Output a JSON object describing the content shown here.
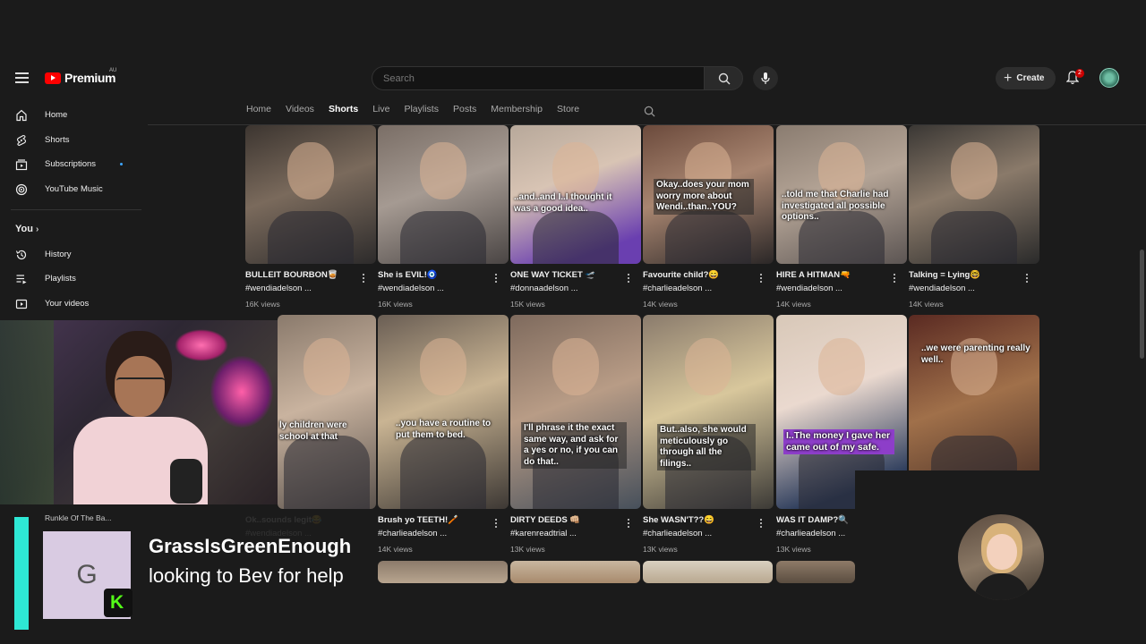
{
  "header": {
    "logo_text": "Premium",
    "region": "AU",
    "search_placeholder": "Search",
    "create_label": "Create",
    "notifications_count": "2"
  },
  "sidebar": {
    "items": [
      {
        "label": "Home",
        "icon": "home-icon"
      },
      {
        "label": "Shorts",
        "icon": "shorts-icon"
      },
      {
        "label": "Subscriptions",
        "icon": "subscriptions-icon"
      },
      {
        "label": "YouTube Music",
        "icon": "music-icon"
      }
    ],
    "you_label": "You",
    "you_items": [
      {
        "label": "History",
        "icon": "history-icon"
      },
      {
        "label": "Playlists",
        "icon": "playlists-icon"
      },
      {
        "label": "Your videos",
        "icon": "your-videos-icon"
      }
    ]
  },
  "tabs": [
    "Home",
    "Videos",
    "Shorts",
    "Live",
    "Playlists",
    "Posts",
    "Membership",
    "Store"
  ],
  "active_tab": "Shorts",
  "shorts_row1": [
    {
      "title": "BULLEIT BOURBON🥃",
      "tag": "#wendiadelson ...",
      "views": "16K views",
      "caption": ""
    },
    {
      "title": "She is EVIL!🧿",
      "tag": "#wendiadelson ...",
      "views": "16K views",
      "caption": ""
    },
    {
      "title": "ONE WAY TICKET 🛫",
      "tag": "#donnaadelson ...",
      "views": "15K views",
      "caption": "..and..and I..I thought it was a good idea.."
    },
    {
      "title": "Favourite child?😄",
      "tag": "#charlieadelson ...",
      "views": "14K views",
      "caption": "Okay..does your mom worry more about Wendi..than..YOU?"
    },
    {
      "title": "HIRE A HITMAN🔫",
      "tag": "#wendiadelson ...",
      "views": "14K views",
      "caption": "..told me that Charlie had investigated all possible options.."
    },
    {
      "title": "Talking = Lying🤓",
      "tag": "#wendiadelson ...",
      "views": "14K views",
      "caption": ""
    }
  ],
  "shorts_row2": [
    {
      "title": "Ok..sounds legit😂",
      "tag": "#wendiadelson ...",
      "views": "",
      "caption": "ly children were school at that"
    },
    {
      "title": "Brush yo TEETH!🪥",
      "tag": "#charlieadelson ...",
      "views": "14K views",
      "caption": "..you have a routine to put them to bed."
    },
    {
      "title": "DIRTY DEEDS 👊🏼",
      "tag": "#karenreadtrial ...",
      "views": "13K views",
      "caption": "I'll phrase it the exact same way, and ask for a yes or no, if you can do that.."
    },
    {
      "title": "She WASN'T??😄",
      "tag": "#charlieadelson ...",
      "views": "13K views",
      "caption": "But..also, she would meticulously go through all the filings.."
    },
    {
      "title": "WAS IT DAMP?🔍",
      "tag": "#charlieadelson ...",
      "views": "13K views",
      "caption": "I..The money I gave her came out of my safe."
    },
    {
      "title": "",
      "tag": "",
      "views": "",
      "caption": "..we were parenting really well.."
    }
  ],
  "stream": {
    "rumble_label": "Runkle Of The Ba...",
    "chat_initial": "G",
    "chat_user": "GrassIsGreenEnough",
    "chat_message": "looking to Bev for help",
    "kick_badge": "K"
  },
  "colors": {
    "accent_red": "#ff0000",
    "chat_bar": "#2ee8d5",
    "kick_green": "#53fc18",
    "caption_purple": "#8d3ec9"
  }
}
